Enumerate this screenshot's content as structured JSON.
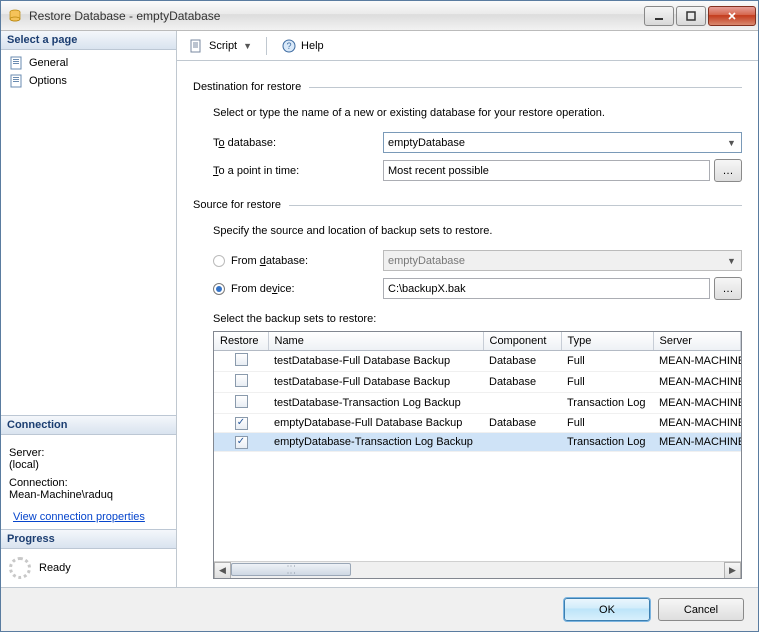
{
  "window": {
    "title": "Restore Database - emptyDatabase"
  },
  "sidebar": {
    "select_page": "Select a page",
    "pages": [
      {
        "label": "General"
      },
      {
        "label": "Options"
      }
    ],
    "connection_header": "Connection",
    "server_label": "Server:",
    "server_value": "(local)",
    "connection_label": "Connection:",
    "connection_value": "Mean-Machine\\raduq",
    "view_props": "View connection properties",
    "progress_header": "Progress",
    "progress_status": "Ready"
  },
  "toolbar": {
    "script": "Script",
    "help": "Help"
  },
  "dest": {
    "group": "Destination for restore",
    "desc": "Select or type the name of a new or existing database for your restore operation.",
    "to_db_label_pre": "T",
    "to_db_label_u": "o",
    "to_db_label_post": " database:",
    "to_db_value": "emptyDatabase",
    "to_pit_label": "To a point in time:",
    "to_pit_value": "Most recent possible"
  },
  "source": {
    "group": "Source for restore",
    "desc": "Specify the source and location of backup sets to restore.",
    "from_db_label": "From database:",
    "from_db_value": "emptyDatabase",
    "from_dev_label": "From device:",
    "from_dev_value": "C:\\backupX.bak",
    "select_sets": "Select the backup sets to restore:"
  },
  "grid": {
    "cols": [
      "Restore",
      "Name",
      "Component",
      "Type",
      "Server"
    ],
    "rows": [
      {
        "checked": false,
        "name": "testDatabase-Full Database Backup",
        "component": "Database",
        "type": "Full",
        "server": "MEAN-MACHINE",
        "sel": false
      },
      {
        "checked": false,
        "name": "testDatabase-Full Database Backup",
        "component": "Database",
        "type": "Full",
        "server": "MEAN-MACHINE",
        "sel": false
      },
      {
        "checked": false,
        "name": "testDatabase-Transaction Log  Backup",
        "component": "",
        "type": "Transaction Log",
        "server": "MEAN-MACHINE",
        "sel": false
      },
      {
        "checked": true,
        "name": "emptyDatabase-Full Database Backup",
        "component": "Database",
        "type": "Full",
        "server": "MEAN-MACHINE",
        "sel": false
      },
      {
        "checked": true,
        "name": "emptyDatabase-Transaction Log  Backup",
        "component": "",
        "type": "Transaction Log",
        "server": "MEAN-MACHINE",
        "sel": true
      }
    ]
  },
  "footer": {
    "ok": "OK",
    "cancel": "Cancel"
  }
}
